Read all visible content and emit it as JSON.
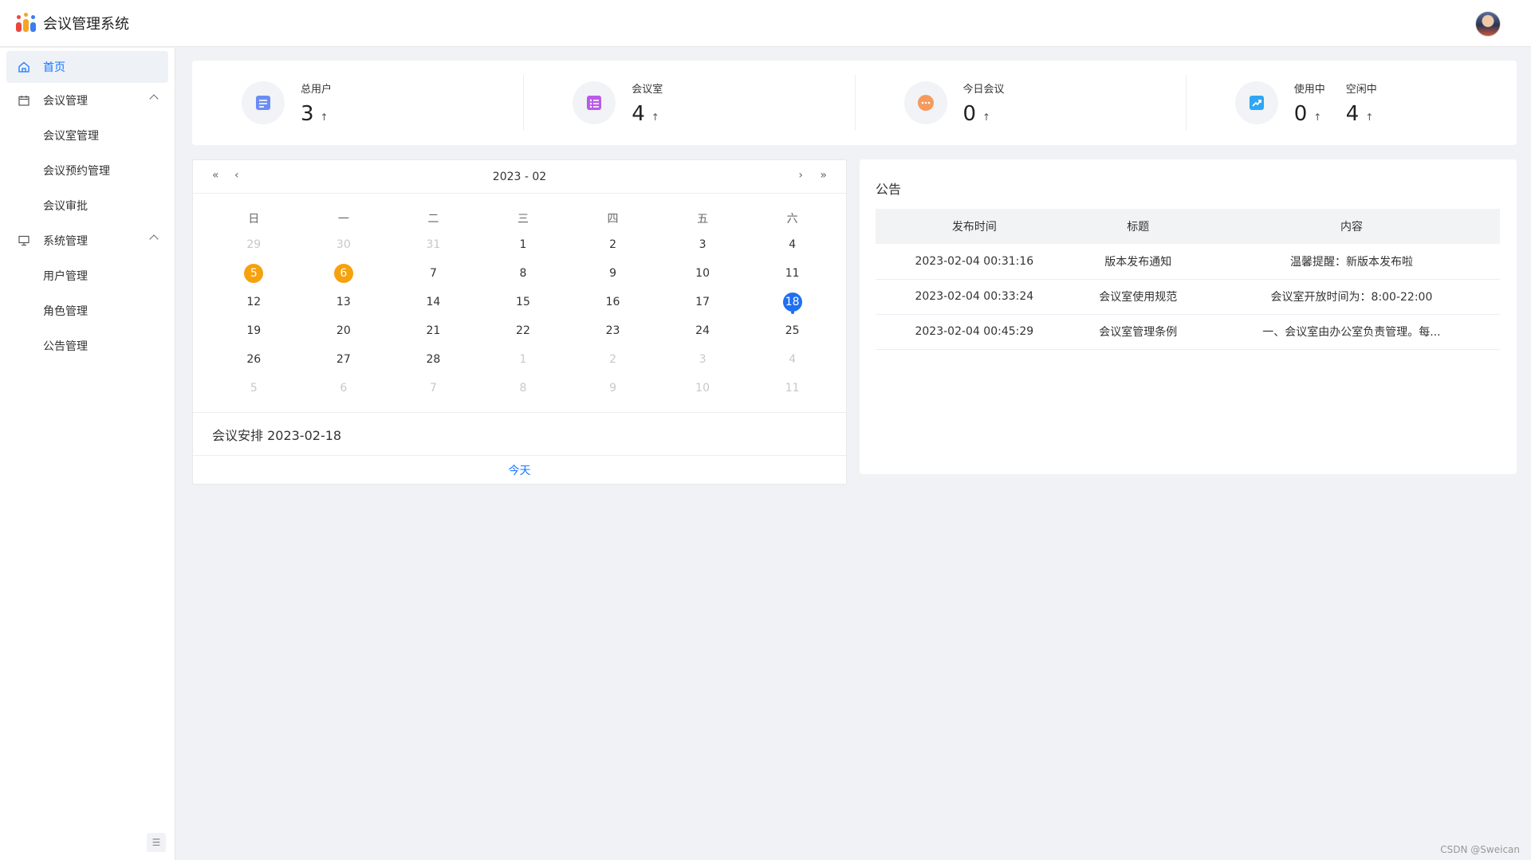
{
  "header": {
    "app_title": "会议管理系统"
  },
  "sidebar": {
    "home": "首页",
    "meeting_mgmt": "会议管理",
    "meeting_room_mgmt": "会议室管理",
    "meeting_booking_mgmt": "会议预约管理",
    "meeting_approval": "会议审批",
    "system_mgmt": "系统管理",
    "user_mgmt": "用户管理",
    "role_mgmt": "角色管理",
    "notice_mgmt": "公告管理"
  },
  "stats": {
    "total_users": {
      "label": "总用户",
      "value": "3",
      "arrow": "↑"
    },
    "meeting_rooms": {
      "label": "会议室",
      "value": "4",
      "arrow": "↑"
    },
    "today_meetings": {
      "label": "今日会议",
      "value": "0",
      "arrow": "↑"
    },
    "in_use": {
      "label": "使用中",
      "value": "0",
      "arrow": "↑"
    },
    "idle": {
      "label": "空闲中",
      "value": "4",
      "arrow": "↑"
    }
  },
  "calendar": {
    "month": "2023 - 02",
    "prev_year": "«",
    "prev_month": "‹",
    "next_month": "›",
    "next_year": "»",
    "weekdays": [
      "日",
      "一",
      "二",
      "三",
      "四",
      "五",
      "六"
    ],
    "weeks": [
      [
        "29",
        "30",
        "31",
        "1",
        "2",
        "3",
        "4"
      ],
      [
        "5",
        "6",
        "7",
        "8",
        "9",
        "10",
        "11"
      ],
      [
        "12",
        "13",
        "14",
        "15",
        "16",
        "17",
        "18"
      ],
      [
        "19",
        "20",
        "21",
        "22",
        "23",
        "24",
        "25"
      ],
      [
        "26",
        "27",
        "28",
        "1",
        "2",
        "3",
        "4"
      ],
      [
        "5",
        "6",
        "7",
        "8",
        "9",
        "10",
        "11"
      ]
    ],
    "schedule": "会议安排 2023-02-18",
    "today_button": "今天"
  },
  "notice": {
    "title": "公告",
    "columns": [
      "发布时间",
      "标题",
      "内容"
    ],
    "rows": [
      [
        "2023-02-04 00:31:16",
        "版本发布通知",
        "温馨提醒：新版本发布啦"
      ],
      [
        "2023-02-04 00:33:24",
        "会议室使用规范",
        "会议室开放时间为：8:00-22:00"
      ],
      [
        "2023-02-04 00:45:29",
        "会议室管理条例",
        "一、会议室由办公室负责管理。每..."
      ]
    ]
  },
  "watermark": "CSDN @Sweican",
  "colors": {
    "accent": "#1677ff",
    "orange": "#f6a10e",
    "selected": "#1f6ff2"
  }
}
